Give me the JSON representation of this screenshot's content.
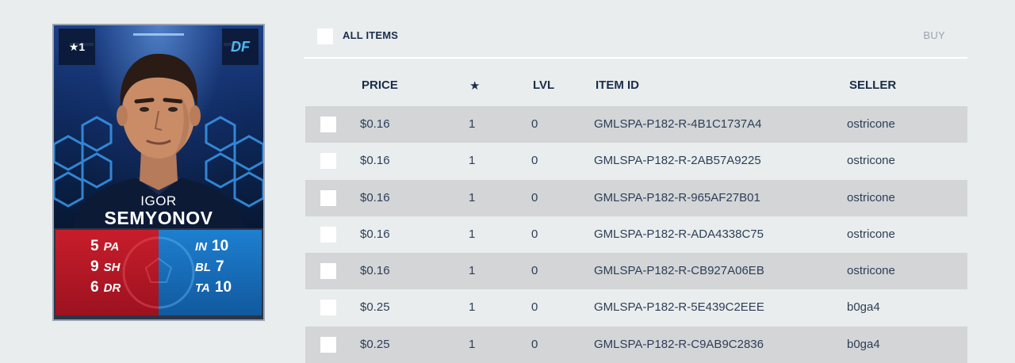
{
  "card": {
    "stars": "★1",
    "position": "DF",
    "first_name": "IGOR",
    "last_name": "SEMYONOV",
    "stats_left": [
      {
        "value": "5",
        "label": "PA"
      },
      {
        "value": "9",
        "label": "SH"
      },
      {
        "value": "6",
        "label": "DR"
      }
    ],
    "stats_right": [
      {
        "label": "IN",
        "value": "10"
      },
      {
        "label": "BL",
        "value": "7"
      },
      {
        "label": "TA",
        "value": "10"
      }
    ],
    "colors": {
      "left_panel": "#c81d2b",
      "right_panel": "#1e7fd0",
      "position_text": "#4fb7ee"
    }
  },
  "toolbar": {
    "select_all_label": "ALL ITEMS",
    "buy_label": "BUY"
  },
  "table": {
    "headers": {
      "price": "PRICE",
      "star": "★",
      "level": "LVL",
      "item_id": "ITEM ID",
      "seller": "SELLER"
    },
    "rows": [
      {
        "price": "$0.16",
        "star": "1",
        "level": "0",
        "item_id": "GMLSPA-P182-R-4B1C1737A4",
        "seller": "ostricone"
      },
      {
        "price": "$0.16",
        "star": "1",
        "level": "0",
        "item_id": "GMLSPA-P182-R-2AB57A9225",
        "seller": "ostricone"
      },
      {
        "price": "$0.16",
        "star": "1",
        "level": "0",
        "item_id": "GMLSPA-P182-R-965AF27B01",
        "seller": "ostricone"
      },
      {
        "price": "$0.16",
        "star": "1",
        "level": "0",
        "item_id": "GMLSPA-P182-R-ADA4338C75",
        "seller": "ostricone"
      },
      {
        "price": "$0.16",
        "star": "1",
        "level": "0",
        "item_id": "GMLSPA-P182-R-CB927A06EB",
        "seller": "ostricone"
      },
      {
        "price": "$0.25",
        "star": "1",
        "level": "0",
        "item_id": "GMLSPA-P182-R-5E439C2EEE",
        "seller": "b0ga4"
      },
      {
        "price": "$0.25",
        "star": "1",
        "level": "0",
        "item_id": "GMLSPA-P182-R-C9AB9C2836",
        "seller": "b0ga4"
      }
    ]
  }
}
